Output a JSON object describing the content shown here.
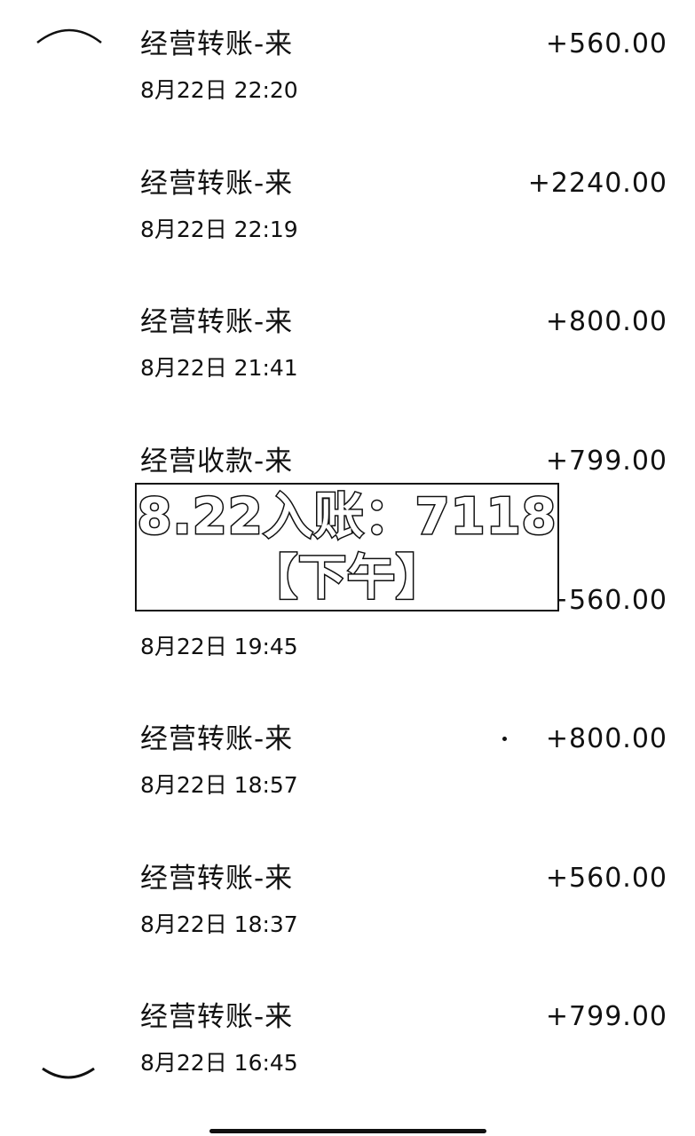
{
  "transactions": [
    {
      "title": "经营转账-来",
      "date": "8月22日 22:20",
      "amount": "+560.00"
    },
    {
      "title": "经营转账-来",
      "date": "8月22日 22:19",
      "amount": "+2240.00"
    },
    {
      "title": "经营转账-来",
      "date": "8月22日 21:41",
      "amount": "+800.00"
    },
    {
      "title": "经营收款-来",
      "date": "",
      "amount": "+799.00"
    },
    {
      "title": "",
      "date": "8月22日 19:45",
      "amount": "+560.00"
    },
    {
      "title": "经营转账-来",
      "date": "8月22日 18:57",
      "amount": "+800.00"
    },
    {
      "title": "经营转账-来",
      "date": "8月22日 18:37",
      "amount": "+560.00"
    },
    {
      "title": "经营转账-来",
      "date": "8月22日 16:45",
      "amount": "+799.00"
    }
  ],
  "overlay": {
    "line1": "8.22入账：7118",
    "line2": "【下午】"
  },
  "icons": {
    "top_avatar": "avatar-icon",
    "bottom_avatar": "avatar-icon",
    "home_indicator": "home-indicator"
  },
  "colors": {
    "text": "#111111",
    "background": "#ffffff"
  }
}
